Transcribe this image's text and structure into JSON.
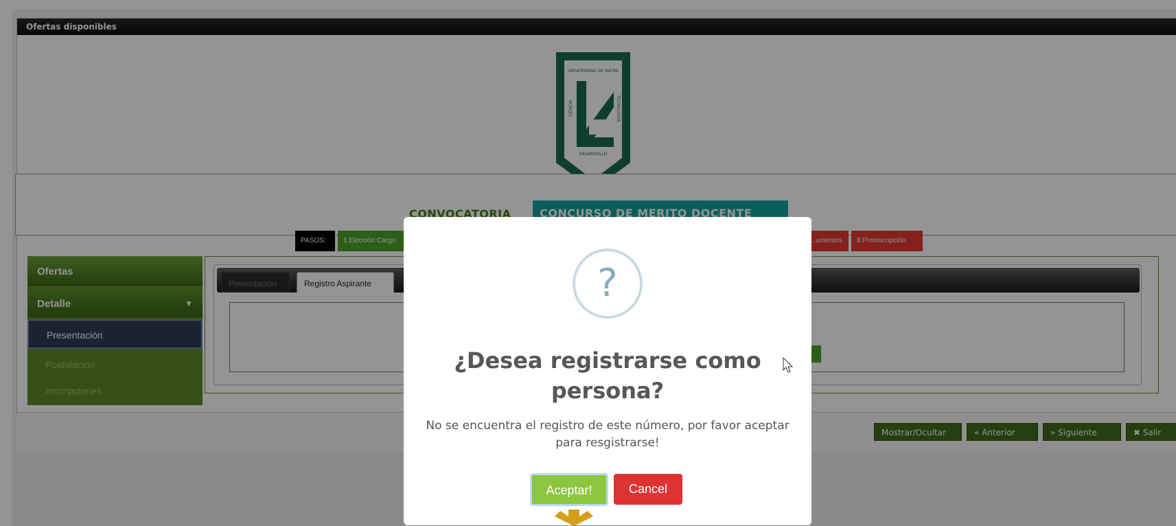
{
  "panel": {
    "title": "Ofertas disponibles"
  },
  "logo": {
    "top_text": "UNIVERSIDAD DE SUCRE",
    "left_text": "CIENCIA",
    "right_text": "TECNOLOGÍA",
    "bottom_text": "DESARROLLO"
  },
  "convocatoria": {
    "label": "CONVOCATORIA",
    "name": "CONCURSO DE MERITO DOCENTE 2023"
  },
  "steps": {
    "label": "PASOS:",
    "items": [
      "1.Elección Cargo",
      "...umentos",
      "8.Preinscripción"
    ]
  },
  "menu": {
    "ofertas": "Ofertas",
    "detalle": "Detalle",
    "items": [
      "Presentación",
      "Postulación",
      "Inscripciones"
    ]
  },
  "tabs": [
    "Presentación",
    "Registro Aspirante"
  ],
  "nav_buttons": {
    "mostrar": "Mostrar/Ocultar",
    "anterior": "« Anterior",
    "siguiente": "» Siguiente",
    "salir": "✖ Salir"
  },
  "modal": {
    "icon": "?",
    "title": "¿Desea registrarse como persona?",
    "text": "No se encuentra el registro de este número, por favor aceptar para resgistrarse!",
    "accept": "Aceptar!",
    "cancel": "Cancel"
  },
  "colors": {
    "accent_green": "#8cc63f",
    "cancel_red": "#dd3333",
    "menu_green": "#5c8a2a",
    "teal": "#14a29f",
    "arrow_gold": "#d4a017"
  }
}
